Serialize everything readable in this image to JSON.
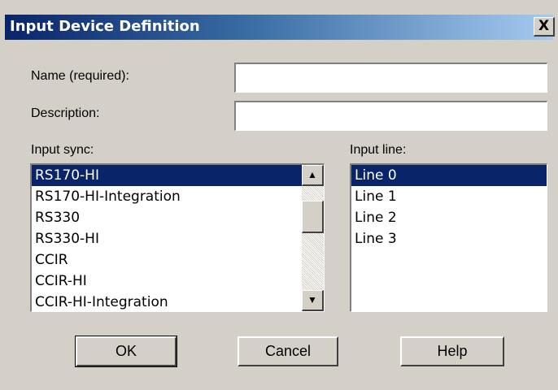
{
  "dialog": {
    "title": "Input Device Definition",
    "close_label": "X"
  },
  "name_field": {
    "label": "Name (required):",
    "value": ""
  },
  "description_field": {
    "label": "Description:",
    "value": ""
  },
  "input_sync": {
    "label": "Input sync:",
    "items": [
      "RS170-HI",
      "RS170-HI-Integration",
      "RS330",
      "RS330-HI",
      "CCIR",
      "CCIR-HI",
      "CCIR-HI-Integration"
    ],
    "selected": "RS170-HI"
  },
  "input_line": {
    "label": "Input line:",
    "items": [
      "Line 0",
      "Line 1",
      "Line 2",
      "Line 3"
    ],
    "selected": "Line 0"
  },
  "buttons": {
    "ok": "OK",
    "cancel": "Cancel",
    "help": "Help"
  },
  "icons": {
    "scroll_up": "arrow-up-icon",
    "scroll_down": "arrow-down-icon",
    "close": "close-icon"
  },
  "colors": {
    "title_bar": "#0a246a",
    "selection": "#0a246a",
    "dialog_face": "#d4d0c8"
  }
}
